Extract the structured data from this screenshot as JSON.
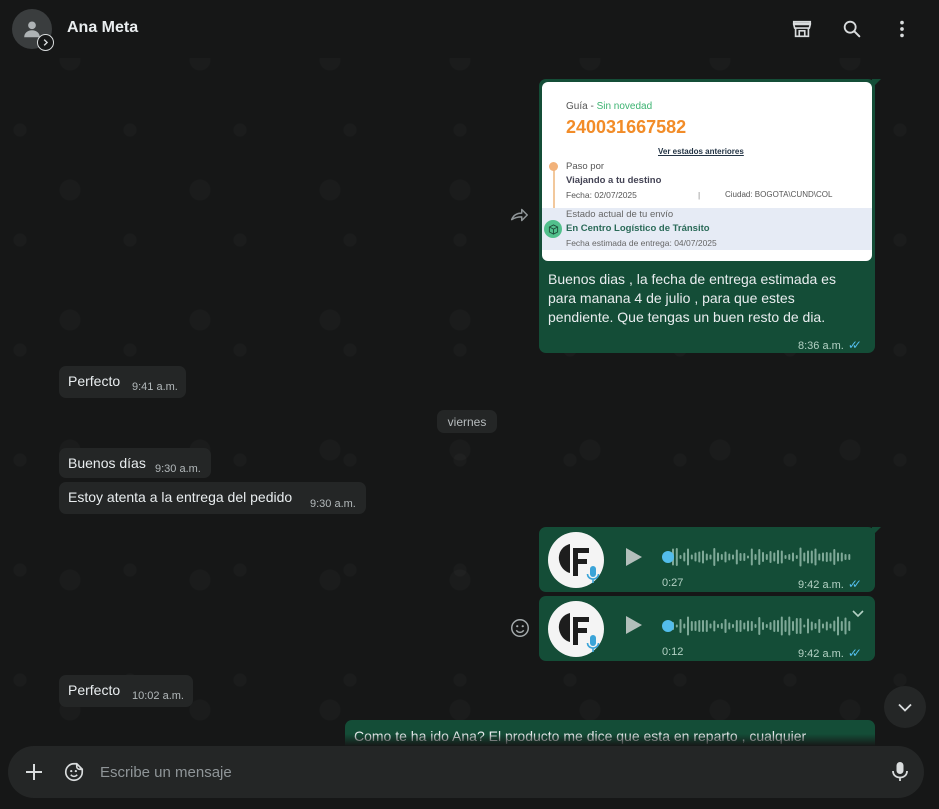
{
  "header": {
    "contact_name": "Ana Meta",
    "icons": [
      "store-icon",
      "search-icon",
      "menu-icon"
    ]
  },
  "colors": {
    "outgoing_bubble": "#144d37",
    "incoming_bubble": "#242626",
    "read_checks": "#53bdeb",
    "accent_orange": "#f28c28"
  },
  "shipping_card": {
    "guia_label": "Guía - ",
    "guia_status": "Sin novedad",
    "tracking_number": "240031667582",
    "previous_states_link": "Ver estados anteriores",
    "paso_label": "Paso por",
    "paso_value": "Viajando a tu destino",
    "fecha": "Fecha: 02/07/2025",
    "separator": "|",
    "ciudad": "Ciudad: BOGOTA\\CUND\\COL",
    "estado_label": "Estado actual de tu envío",
    "estado_value": "En Centro Logístico de Tránsito",
    "estimated_delivery": "Fecha estimada de entrega: 04/07/2025"
  },
  "messages": [
    {
      "id": "m1",
      "direction": "out",
      "line1": "Buenos dias , la fecha de entrega estimada es",
      "line2": "para manana 4 de julio  , para que estes",
      "line3": "pendiente. Que tengas un buen resto de dia.",
      "time": "8:36 a.m."
    },
    {
      "id": "m2",
      "direction": "in",
      "text": "Perfecto",
      "time": "9:41 a.m."
    },
    {
      "id": "m3",
      "direction": "in",
      "text": "Buenos días",
      "time": "9:30 a.m."
    },
    {
      "id": "m4",
      "direction": "in",
      "text": "Estoy atenta a la entrega del pedido",
      "time": "9:30 a.m."
    },
    {
      "id": "m5",
      "direction": "out",
      "type": "audio",
      "duration": "0:27",
      "time": "9:42 a.m.",
      "progress": 0
    },
    {
      "id": "m6",
      "direction": "out",
      "type": "audio",
      "duration": "0:12",
      "time": "9:42 a.m.",
      "progress": 0
    },
    {
      "id": "m7",
      "direction": "in",
      "text": "Perfecto",
      "time": "10:02 a.m."
    },
    {
      "id": "m8",
      "direction": "out",
      "text": "Como te ha ido Ana? El producto me dice que esta en reparto , cualquier"
    }
  ],
  "date_divider": "viernes",
  "composer": {
    "placeholder": "Escribe un mensaje"
  }
}
